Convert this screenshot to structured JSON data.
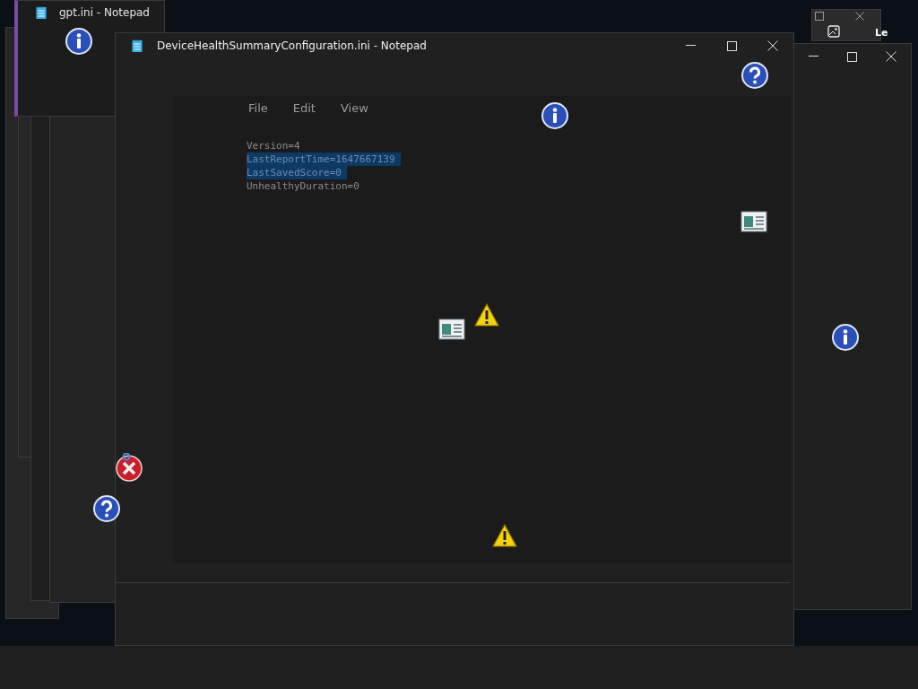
{
  "background_window": {
    "title": "gpt.ini - Notepad"
  },
  "corner_window": {
    "text": "Le"
  },
  "window": {
    "title": "DeviceHealthSummaryConfiguration.ini - Notepad",
    "menu": [
      "File",
      "Edit",
      "View"
    ],
    "lines": [
      {
        "text": "Version=4",
        "selected": false
      },
      {
        "text": "LastReportTime=1647667139",
        "selected": true
      },
      {
        "text": "LastSavedScore=0",
        "selected": true
      },
      {
        "text": "UnhealthyDuration=0",
        "selected": false
      }
    ]
  }
}
